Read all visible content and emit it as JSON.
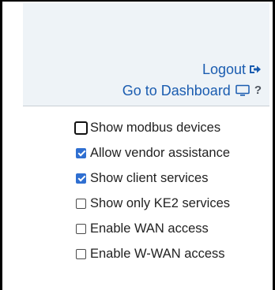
{
  "header": {
    "logout_label": "Logout",
    "dashboard_label": "Go to Dashboard",
    "help_label": "?",
    "icons": {
      "logout": "sign-out-icon",
      "dashboard": "monitor-icon",
      "help": "question-mark-icon"
    }
  },
  "colors": {
    "link": "#1a5cb0",
    "checkbox_checked": "#2f6fd1",
    "header_bg": "#eef3f7"
  },
  "options": [
    {
      "label": "Show modbus devices",
      "checked": false,
      "focused": true
    },
    {
      "label": "Allow vendor assistance",
      "checked": true,
      "focused": false
    },
    {
      "label": "Show client services",
      "checked": true,
      "focused": false
    },
    {
      "label": "Show only KE2 services",
      "checked": false,
      "focused": false
    },
    {
      "label": "Enable WAN access",
      "checked": false,
      "focused": false
    },
    {
      "label": "Enable W-WAN access",
      "checked": false,
      "focused": false
    }
  ]
}
